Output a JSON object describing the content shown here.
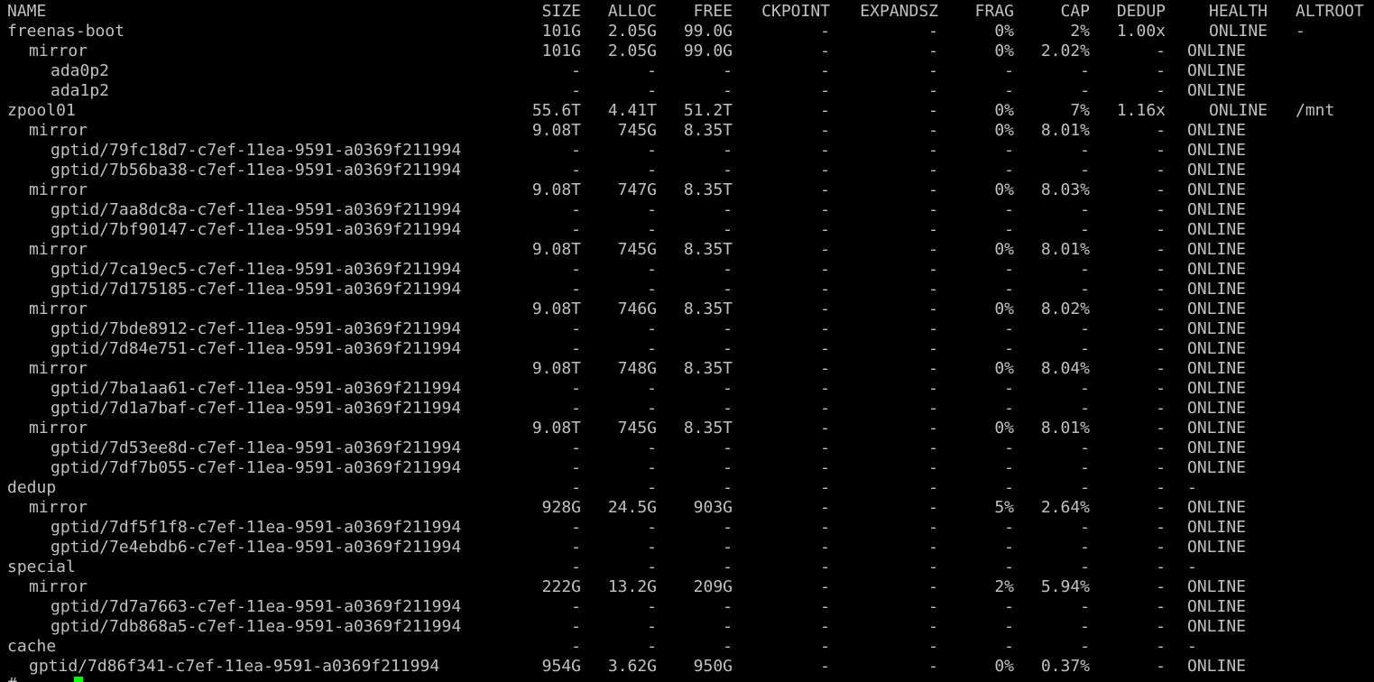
{
  "terminal": {
    "prompt": "# ",
    "columns": [
      "NAME",
      "SIZE",
      "ALLOC",
      "FREE",
      "CKPOINT",
      "EXPANDSZ",
      "FRAG",
      "CAP",
      "DEDUP",
      "HEALTH",
      "ALTROOT"
    ],
    "rows": [
      {
        "name": "freenas-boot",
        "indent": 0,
        "size": "101G",
        "alloc": "2.05G",
        "free": "99.0G",
        "ckpoint": "-",
        "expandsz": "-",
        "frag": "0%",
        "cap": "2%",
        "dedup": "1.00x",
        "health": "ONLINE",
        "altroot": "-"
      },
      {
        "name": "mirror",
        "indent": 1,
        "size": "101G",
        "alloc": "2.05G",
        "free": "99.0G",
        "ckpoint": "-",
        "expandsz": "-",
        "frag": "0%",
        "cap": "2.02%",
        "dedup": "-",
        "health": "ONLINE",
        "altroot": ""
      },
      {
        "name": "ada0p2",
        "indent": 2,
        "size": "-",
        "alloc": "-",
        "free": "-",
        "ckpoint": "-",
        "expandsz": "-",
        "frag": "-",
        "cap": "-",
        "dedup": "-",
        "health": "ONLINE",
        "altroot": ""
      },
      {
        "name": "ada1p2",
        "indent": 2,
        "size": "-",
        "alloc": "-",
        "free": "-",
        "ckpoint": "-",
        "expandsz": "-",
        "frag": "-",
        "cap": "-",
        "dedup": "-",
        "health": "ONLINE",
        "altroot": ""
      },
      {
        "name": "zpool01",
        "indent": 0,
        "size": "55.6T",
        "alloc": "4.41T",
        "free": "51.2T",
        "ckpoint": "-",
        "expandsz": "-",
        "frag": "0%",
        "cap": "7%",
        "dedup": "1.16x",
        "health": "ONLINE",
        "altroot": "/mnt"
      },
      {
        "name": "mirror",
        "indent": 1,
        "size": "9.08T",
        "alloc": "745G",
        "free": "8.35T",
        "ckpoint": "-",
        "expandsz": "-",
        "frag": "0%",
        "cap": "8.01%",
        "dedup": "-",
        "health": "ONLINE",
        "altroot": ""
      },
      {
        "name": "gptid/79fc18d7-c7ef-11ea-9591-a0369f211994",
        "indent": 2,
        "size": "-",
        "alloc": "-",
        "free": "-",
        "ckpoint": "-",
        "expandsz": "-",
        "frag": "-",
        "cap": "-",
        "dedup": "-",
        "health": "ONLINE",
        "altroot": ""
      },
      {
        "name": "gptid/7b56ba38-c7ef-11ea-9591-a0369f211994",
        "indent": 2,
        "size": "-",
        "alloc": "-",
        "free": "-",
        "ckpoint": "-",
        "expandsz": "-",
        "frag": "-",
        "cap": "-",
        "dedup": "-",
        "health": "ONLINE",
        "altroot": ""
      },
      {
        "name": "mirror",
        "indent": 1,
        "size": "9.08T",
        "alloc": "747G",
        "free": "8.35T",
        "ckpoint": "-",
        "expandsz": "-",
        "frag": "0%",
        "cap": "8.03%",
        "dedup": "-",
        "health": "ONLINE",
        "altroot": ""
      },
      {
        "name": "gptid/7aa8dc8a-c7ef-11ea-9591-a0369f211994",
        "indent": 2,
        "size": "-",
        "alloc": "-",
        "free": "-",
        "ckpoint": "-",
        "expandsz": "-",
        "frag": "-",
        "cap": "-",
        "dedup": "-",
        "health": "ONLINE",
        "altroot": ""
      },
      {
        "name": "gptid/7bf90147-c7ef-11ea-9591-a0369f211994",
        "indent": 2,
        "size": "-",
        "alloc": "-",
        "free": "-",
        "ckpoint": "-",
        "expandsz": "-",
        "frag": "-",
        "cap": "-",
        "dedup": "-",
        "health": "ONLINE",
        "altroot": ""
      },
      {
        "name": "mirror",
        "indent": 1,
        "size": "9.08T",
        "alloc": "745G",
        "free": "8.35T",
        "ckpoint": "-",
        "expandsz": "-",
        "frag": "0%",
        "cap": "8.01%",
        "dedup": "-",
        "health": "ONLINE",
        "altroot": ""
      },
      {
        "name": "gptid/7ca19ec5-c7ef-11ea-9591-a0369f211994",
        "indent": 2,
        "size": "-",
        "alloc": "-",
        "free": "-",
        "ckpoint": "-",
        "expandsz": "-",
        "frag": "-",
        "cap": "-",
        "dedup": "-",
        "health": "ONLINE",
        "altroot": ""
      },
      {
        "name": "gptid/7d175185-c7ef-11ea-9591-a0369f211994",
        "indent": 2,
        "size": "-",
        "alloc": "-",
        "free": "-",
        "ckpoint": "-",
        "expandsz": "-",
        "frag": "-",
        "cap": "-",
        "dedup": "-",
        "health": "ONLINE",
        "altroot": ""
      },
      {
        "name": "mirror",
        "indent": 1,
        "size": "9.08T",
        "alloc": "746G",
        "free": "8.35T",
        "ckpoint": "-",
        "expandsz": "-",
        "frag": "0%",
        "cap": "8.02%",
        "dedup": "-",
        "health": "ONLINE",
        "altroot": ""
      },
      {
        "name": "gptid/7bde8912-c7ef-11ea-9591-a0369f211994",
        "indent": 2,
        "size": "-",
        "alloc": "-",
        "free": "-",
        "ckpoint": "-",
        "expandsz": "-",
        "frag": "-",
        "cap": "-",
        "dedup": "-",
        "health": "ONLINE",
        "altroot": ""
      },
      {
        "name": "gptid/7d84e751-c7ef-11ea-9591-a0369f211994",
        "indent": 2,
        "size": "-",
        "alloc": "-",
        "free": "-",
        "ckpoint": "-",
        "expandsz": "-",
        "frag": "-",
        "cap": "-",
        "dedup": "-",
        "health": "ONLINE",
        "altroot": ""
      },
      {
        "name": "mirror",
        "indent": 1,
        "size": "9.08T",
        "alloc": "748G",
        "free": "8.35T",
        "ckpoint": "-",
        "expandsz": "-",
        "frag": "0%",
        "cap": "8.04%",
        "dedup": "-",
        "health": "ONLINE",
        "altroot": ""
      },
      {
        "name": "gptid/7ba1aa61-c7ef-11ea-9591-a0369f211994",
        "indent": 2,
        "size": "-",
        "alloc": "-",
        "free": "-",
        "ckpoint": "-",
        "expandsz": "-",
        "frag": "-",
        "cap": "-",
        "dedup": "-",
        "health": "ONLINE",
        "altroot": ""
      },
      {
        "name": "gptid/7d1a7baf-c7ef-11ea-9591-a0369f211994",
        "indent": 2,
        "size": "-",
        "alloc": "-",
        "free": "-",
        "ckpoint": "-",
        "expandsz": "-",
        "frag": "-",
        "cap": "-",
        "dedup": "-",
        "health": "ONLINE",
        "altroot": ""
      },
      {
        "name": "mirror",
        "indent": 1,
        "size": "9.08T",
        "alloc": "745G",
        "free": "8.35T",
        "ckpoint": "-",
        "expandsz": "-",
        "frag": "0%",
        "cap": "8.01%",
        "dedup": "-",
        "health": "ONLINE",
        "altroot": ""
      },
      {
        "name": "gptid/7d53ee8d-c7ef-11ea-9591-a0369f211994",
        "indent": 2,
        "size": "-",
        "alloc": "-",
        "free": "-",
        "ckpoint": "-",
        "expandsz": "-",
        "frag": "-",
        "cap": "-",
        "dedup": "-",
        "health": "ONLINE",
        "altroot": ""
      },
      {
        "name": "gptid/7df7b055-c7ef-11ea-9591-a0369f211994",
        "indent": 2,
        "size": "-",
        "alloc": "-",
        "free": "-",
        "ckpoint": "-",
        "expandsz": "-",
        "frag": "-",
        "cap": "-",
        "dedup": "-",
        "health": "ONLINE",
        "altroot": ""
      },
      {
        "name": "dedup",
        "indent": 0,
        "size": "-",
        "alloc": "-",
        "free": "-",
        "ckpoint": "-",
        "expandsz": "-",
        "frag": "-",
        "cap": "-",
        "dedup": "-",
        "health": "-",
        "altroot": ""
      },
      {
        "name": "mirror",
        "indent": 1,
        "size": "928G",
        "alloc": "24.5G",
        "free": "903G",
        "ckpoint": "-",
        "expandsz": "-",
        "frag": "5%",
        "cap": "2.64%",
        "dedup": "-",
        "health": "ONLINE",
        "altroot": ""
      },
      {
        "name": "gptid/7df5f1f8-c7ef-11ea-9591-a0369f211994",
        "indent": 2,
        "size": "-",
        "alloc": "-",
        "free": "-",
        "ckpoint": "-",
        "expandsz": "-",
        "frag": "-",
        "cap": "-",
        "dedup": "-",
        "health": "ONLINE",
        "altroot": ""
      },
      {
        "name": "gptid/7e4ebdb6-c7ef-11ea-9591-a0369f211994",
        "indent": 2,
        "size": "-",
        "alloc": "-",
        "free": "-",
        "ckpoint": "-",
        "expandsz": "-",
        "frag": "-",
        "cap": "-",
        "dedup": "-",
        "health": "ONLINE",
        "altroot": ""
      },
      {
        "name": "special",
        "indent": 0,
        "size": "-",
        "alloc": "-",
        "free": "-",
        "ckpoint": "-",
        "expandsz": "-",
        "frag": "-",
        "cap": "-",
        "dedup": "-",
        "health": "-",
        "altroot": ""
      },
      {
        "name": "mirror",
        "indent": 1,
        "size": "222G",
        "alloc": "13.2G",
        "free": "209G",
        "ckpoint": "-",
        "expandsz": "-",
        "frag": "2%",
        "cap": "5.94%",
        "dedup": "-",
        "health": "ONLINE",
        "altroot": ""
      },
      {
        "name": "gptid/7d7a7663-c7ef-11ea-9591-a0369f211994",
        "indent": 2,
        "size": "-",
        "alloc": "-",
        "free": "-",
        "ckpoint": "-",
        "expandsz": "-",
        "frag": "-",
        "cap": "-",
        "dedup": "-",
        "health": "ONLINE",
        "altroot": ""
      },
      {
        "name": "gptid/7db868a5-c7ef-11ea-9591-a0369f211994",
        "indent": 2,
        "size": "-",
        "alloc": "-",
        "free": "-",
        "ckpoint": "-",
        "expandsz": "-",
        "frag": "-",
        "cap": "-",
        "dedup": "-",
        "health": "ONLINE",
        "altroot": ""
      },
      {
        "name": "cache",
        "indent": 0,
        "size": "-",
        "alloc": "-",
        "free": "-",
        "ckpoint": "-",
        "expandsz": "-",
        "frag": "-",
        "cap": "-",
        "dedup": "-",
        "health": "-",
        "altroot": ""
      },
      {
        "name": "gptid/7d86f341-c7ef-11ea-9591-a0369f211994",
        "indent": 1,
        "size": "954G",
        "alloc": "3.62G",
        "free": "950G",
        "ckpoint": "-",
        "expandsz": "-",
        "frag": "0%",
        "cap": "0.37%",
        "dedup": "-",
        "health": "ONLINE",
        "altroot": ""
      }
    ]
  },
  "colors": {
    "background": "#000000",
    "text": "#c0c0c0",
    "cursor": "#00ff00"
  }
}
